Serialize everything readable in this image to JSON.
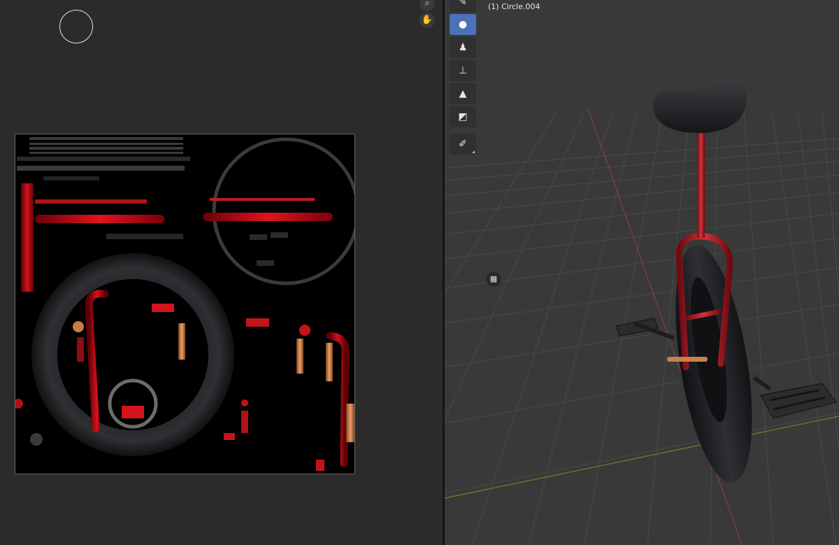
{
  "viewport": {
    "object_name": "(1) Circle.004",
    "grid_color": "#4a4a4a",
    "x_axis_color": "#8d3a3a",
    "y_axis_color": "#5d8b2b"
  },
  "toolbar": {
    "tools": [
      {
        "name": "draw",
        "icon": "brush-icon"
      },
      {
        "name": "soften",
        "icon": "drop-icon"
      },
      {
        "name": "smear",
        "icon": "smear-icon"
      },
      {
        "name": "clone",
        "icon": "stamp-icon"
      },
      {
        "name": "fill",
        "icon": "bucket-icon"
      },
      {
        "name": "mask",
        "icon": "mask-icon"
      },
      {
        "name": "annotate",
        "icon": "pencil-icon"
      }
    ],
    "active": "soften"
  },
  "image_editor": {
    "navigation": [
      "zoom-icon",
      "hand-icon"
    ]
  },
  "colors": {
    "unicycle_frame": "#b0121a",
    "tire": "#1d1f22",
    "pedal": "#2a2c2e",
    "hub": "#c6814d"
  }
}
